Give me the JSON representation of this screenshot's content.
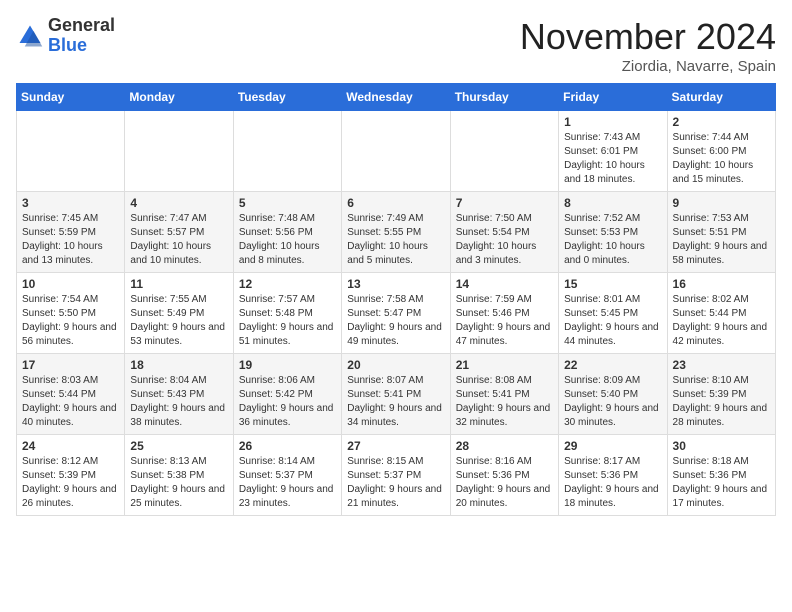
{
  "logo": {
    "general": "General",
    "blue": "Blue"
  },
  "title": "November 2024",
  "location": "Ziordia, Navarre, Spain",
  "days_of_week": [
    "Sunday",
    "Monday",
    "Tuesday",
    "Wednesday",
    "Thursday",
    "Friday",
    "Saturday"
  ],
  "weeks": [
    [
      {
        "day": "",
        "info": ""
      },
      {
        "day": "",
        "info": ""
      },
      {
        "day": "",
        "info": ""
      },
      {
        "day": "",
        "info": ""
      },
      {
        "day": "",
        "info": ""
      },
      {
        "day": "1",
        "info": "Sunrise: 7:43 AM\nSunset: 6:01 PM\nDaylight: 10 hours and 18 minutes."
      },
      {
        "day": "2",
        "info": "Sunrise: 7:44 AM\nSunset: 6:00 PM\nDaylight: 10 hours and 15 minutes."
      }
    ],
    [
      {
        "day": "3",
        "info": "Sunrise: 7:45 AM\nSunset: 5:59 PM\nDaylight: 10 hours and 13 minutes."
      },
      {
        "day": "4",
        "info": "Sunrise: 7:47 AM\nSunset: 5:57 PM\nDaylight: 10 hours and 10 minutes."
      },
      {
        "day": "5",
        "info": "Sunrise: 7:48 AM\nSunset: 5:56 PM\nDaylight: 10 hours and 8 minutes."
      },
      {
        "day": "6",
        "info": "Sunrise: 7:49 AM\nSunset: 5:55 PM\nDaylight: 10 hours and 5 minutes."
      },
      {
        "day": "7",
        "info": "Sunrise: 7:50 AM\nSunset: 5:54 PM\nDaylight: 10 hours and 3 minutes."
      },
      {
        "day": "8",
        "info": "Sunrise: 7:52 AM\nSunset: 5:53 PM\nDaylight: 10 hours and 0 minutes."
      },
      {
        "day": "9",
        "info": "Sunrise: 7:53 AM\nSunset: 5:51 PM\nDaylight: 9 hours and 58 minutes."
      }
    ],
    [
      {
        "day": "10",
        "info": "Sunrise: 7:54 AM\nSunset: 5:50 PM\nDaylight: 9 hours and 56 minutes."
      },
      {
        "day": "11",
        "info": "Sunrise: 7:55 AM\nSunset: 5:49 PM\nDaylight: 9 hours and 53 minutes."
      },
      {
        "day": "12",
        "info": "Sunrise: 7:57 AM\nSunset: 5:48 PM\nDaylight: 9 hours and 51 minutes."
      },
      {
        "day": "13",
        "info": "Sunrise: 7:58 AM\nSunset: 5:47 PM\nDaylight: 9 hours and 49 minutes."
      },
      {
        "day": "14",
        "info": "Sunrise: 7:59 AM\nSunset: 5:46 PM\nDaylight: 9 hours and 47 minutes."
      },
      {
        "day": "15",
        "info": "Sunrise: 8:01 AM\nSunset: 5:45 PM\nDaylight: 9 hours and 44 minutes."
      },
      {
        "day": "16",
        "info": "Sunrise: 8:02 AM\nSunset: 5:44 PM\nDaylight: 9 hours and 42 minutes."
      }
    ],
    [
      {
        "day": "17",
        "info": "Sunrise: 8:03 AM\nSunset: 5:44 PM\nDaylight: 9 hours and 40 minutes."
      },
      {
        "day": "18",
        "info": "Sunrise: 8:04 AM\nSunset: 5:43 PM\nDaylight: 9 hours and 38 minutes."
      },
      {
        "day": "19",
        "info": "Sunrise: 8:06 AM\nSunset: 5:42 PM\nDaylight: 9 hours and 36 minutes."
      },
      {
        "day": "20",
        "info": "Sunrise: 8:07 AM\nSunset: 5:41 PM\nDaylight: 9 hours and 34 minutes."
      },
      {
        "day": "21",
        "info": "Sunrise: 8:08 AM\nSunset: 5:41 PM\nDaylight: 9 hours and 32 minutes."
      },
      {
        "day": "22",
        "info": "Sunrise: 8:09 AM\nSunset: 5:40 PM\nDaylight: 9 hours and 30 minutes."
      },
      {
        "day": "23",
        "info": "Sunrise: 8:10 AM\nSunset: 5:39 PM\nDaylight: 9 hours and 28 minutes."
      }
    ],
    [
      {
        "day": "24",
        "info": "Sunrise: 8:12 AM\nSunset: 5:39 PM\nDaylight: 9 hours and 26 minutes."
      },
      {
        "day": "25",
        "info": "Sunrise: 8:13 AM\nSunset: 5:38 PM\nDaylight: 9 hours and 25 minutes."
      },
      {
        "day": "26",
        "info": "Sunrise: 8:14 AM\nSunset: 5:37 PM\nDaylight: 9 hours and 23 minutes."
      },
      {
        "day": "27",
        "info": "Sunrise: 8:15 AM\nSunset: 5:37 PM\nDaylight: 9 hours and 21 minutes."
      },
      {
        "day": "28",
        "info": "Sunrise: 8:16 AM\nSunset: 5:36 PM\nDaylight: 9 hours and 20 minutes."
      },
      {
        "day": "29",
        "info": "Sunrise: 8:17 AM\nSunset: 5:36 PM\nDaylight: 9 hours and 18 minutes."
      },
      {
        "day": "30",
        "info": "Sunrise: 8:18 AM\nSunset: 5:36 PM\nDaylight: 9 hours and 17 minutes."
      }
    ]
  ]
}
